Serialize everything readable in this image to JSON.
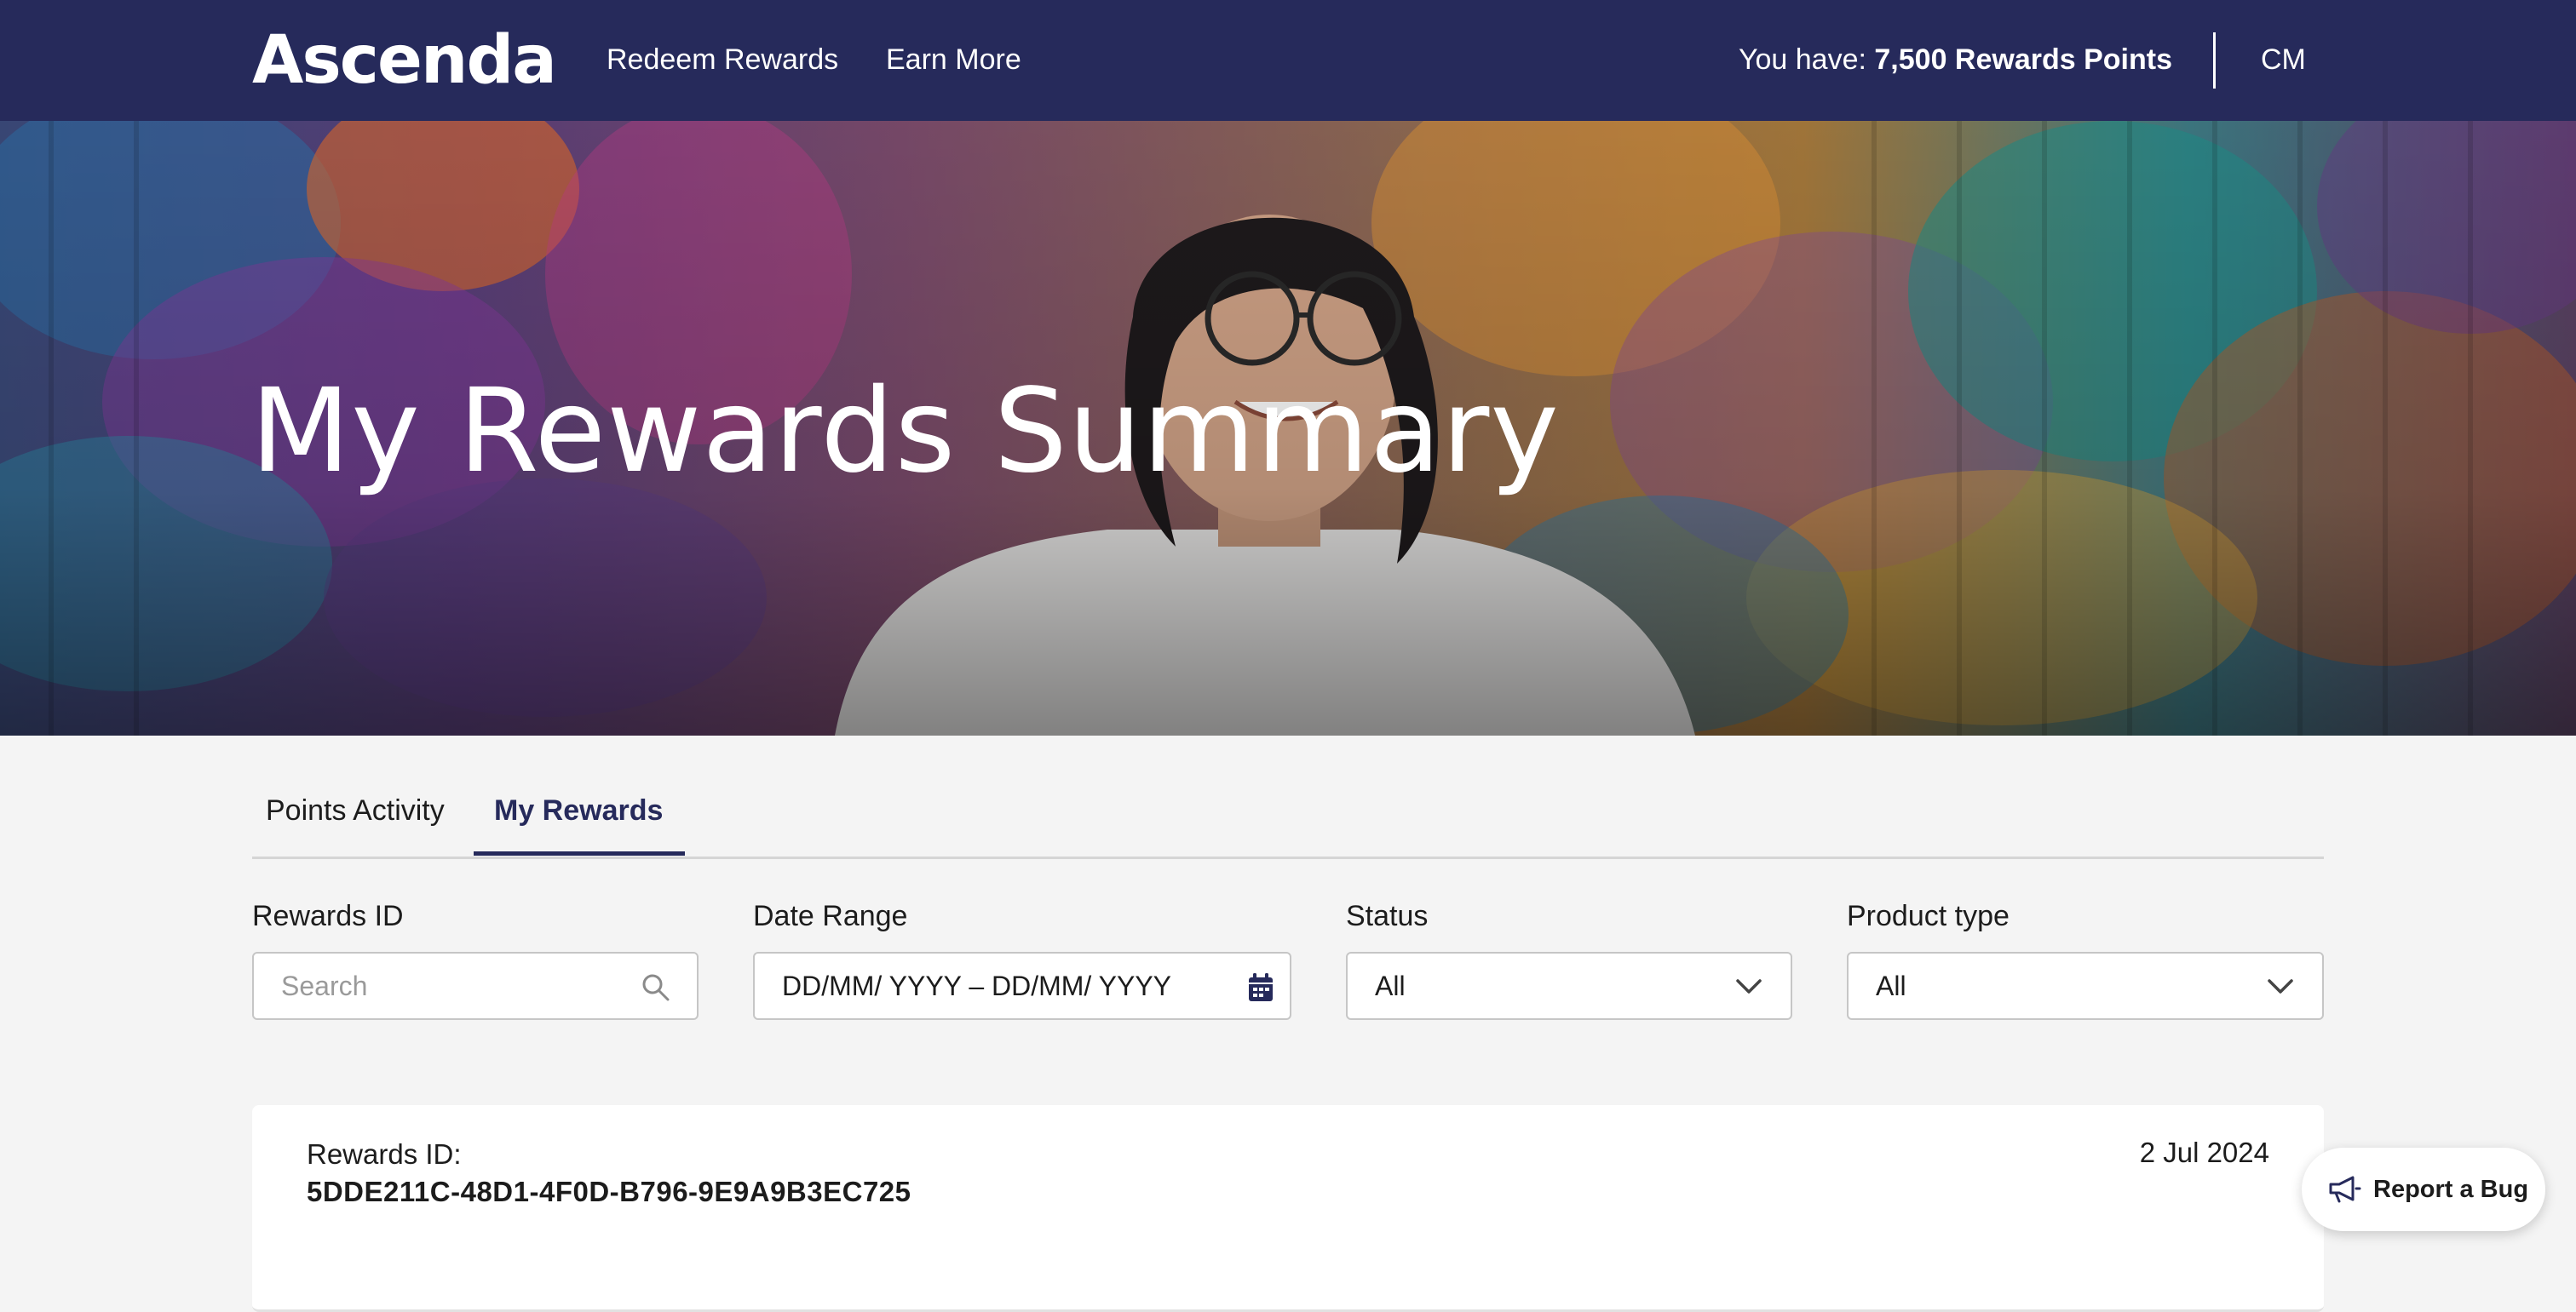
{
  "header": {
    "logo_text": "Ascenda",
    "nav": [
      "Redeem Rewards",
      "Earn More"
    ],
    "points_prefix": "You have: ",
    "points_value": "7,500 Rewards Points",
    "user_initials": "CM"
  },
  "hero": {
    "title": "My Rewards Summary"
  },
  "tabs": [
    {
      "label": "Points Activity",
      "active": false
    },
    {
      "label": "My Rewards",
      "active": true
    }
  ],
  "filters": {
    "rewards_id": {
      "label": "Rewards ID",
      "placeholder": "Search",
      "icon": "search-icon"
    },
    "date_range": {
      "label": "Date Range",
      "value": "DD/MM/ YYYY – DD/MM/ YYYY",
      "icon": "calendar-icon"
    },
    "status": {
      "label": "Status",
      "value": "All",
      "icon": "chevron-down-icon"
    },
    "product_type": {
      "label": "Product type",
      "value": "All",
      "icon": "chevron-down-icon"
    }
  },
  "rewards": [
    {
      "id_label": "Rewards ID:",
      "id": "5DDE211C-48D1-4F0D-B796-9E9A9B3EC725",
      "date": "2 Jul 2024"
    }
  ],
  "report_bug": {
    "label": "Report a Bug",
    "icon": "megaphone-icon"
  },
  "colors": {
    "brand_navy": "#262a5b",
    "page_bg": "#f4f4f4"
  }
}
